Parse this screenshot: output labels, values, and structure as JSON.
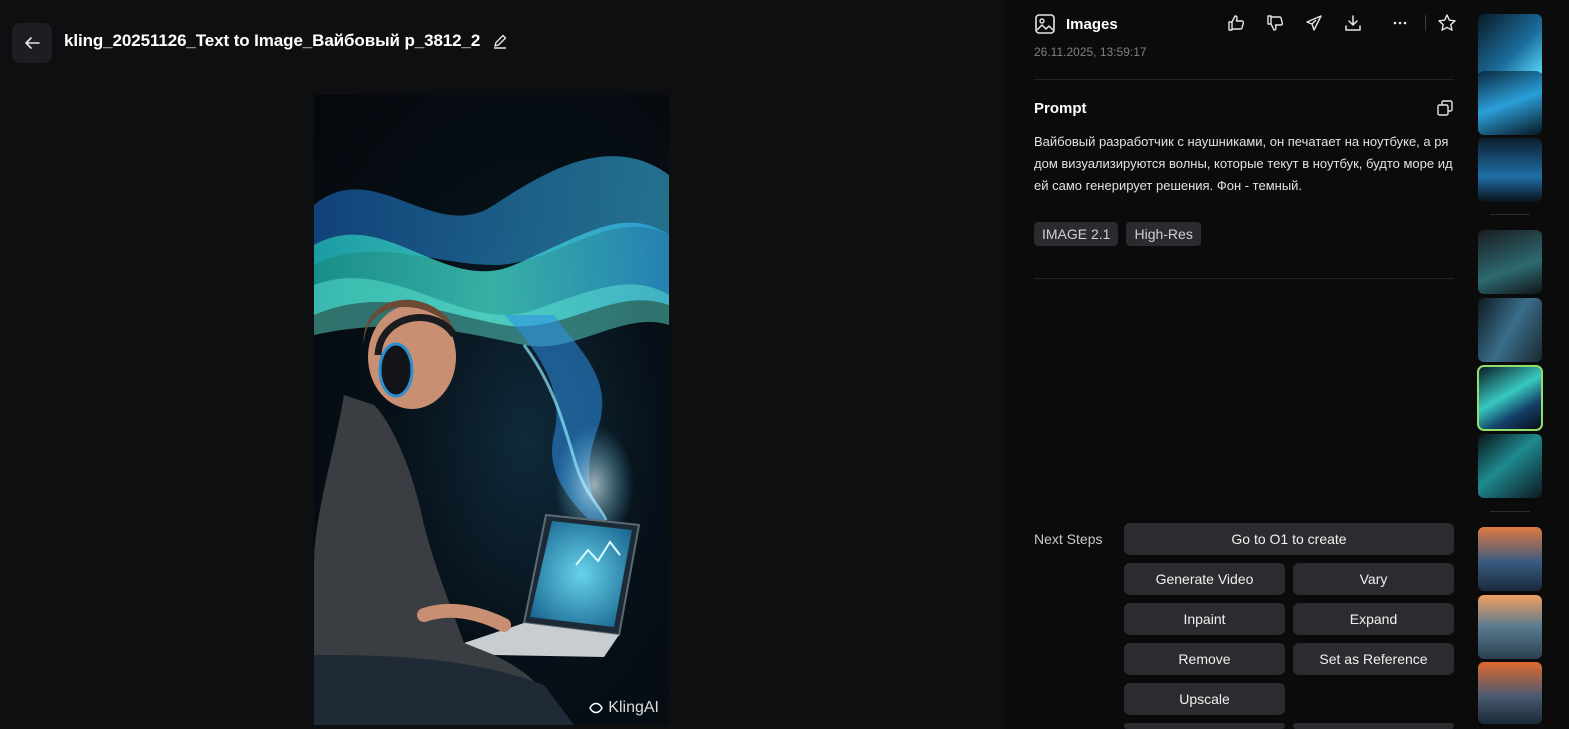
{
  "header": {
    "title": "kling_20251126_Text to Image_Вайбовый р_3812_2"
  },
  "image": {
    "watermark": "KlingAI"
  },
  "panel": {
    "section_title": "Images",
    "timestamp": "26.11.2025, 13:59:17",
    "actions": [
      "thumbs-up-icon",
      "thumbs-down-icon",
      "share-icon",
      "download-icon",
      "more-icon",
      "star-icon"
    ],
    "prompt_label": "Prompt",
    "prompt_lines": [
      "Вайбовый разработчик с наушниками, он печатает на ноутбуке, а ря",
      "дом визуализируются волны, которые текут в ноутбук, будто море ид",
      "ей само генерирует решения. Фон - темный."
    ],
    "tags": [
      "IMAGE 2.1",
      "High-Res"
    ],
    "next_steps_label": "Next Steps",
    "next_steps": {
      "o1": "Go to O1 to create",
      "generate_video": "Generate Video",
      "vary": "Vary",
      "inpaint": "Inpaint",
      "expand": "Expand",
      "remove": "Remove",
      "set_reference": "Set as Reference",
      "upscale": "Upscale"
    }
  },
  "thumbnails": {
    "count": 10,
    "selected_index": 5
  },
  "colors": {
    "background": "#0d0e10",
    "panel": "#0b0b0c",
    "button": "#2b2c2f",
    "tag": "#2a2b2f",
    "selected_outline": "#8ee06a",
    "wave_cyan": "#3fe0d0",
    "wave_blue": "#2f8fe0"
  }
}
